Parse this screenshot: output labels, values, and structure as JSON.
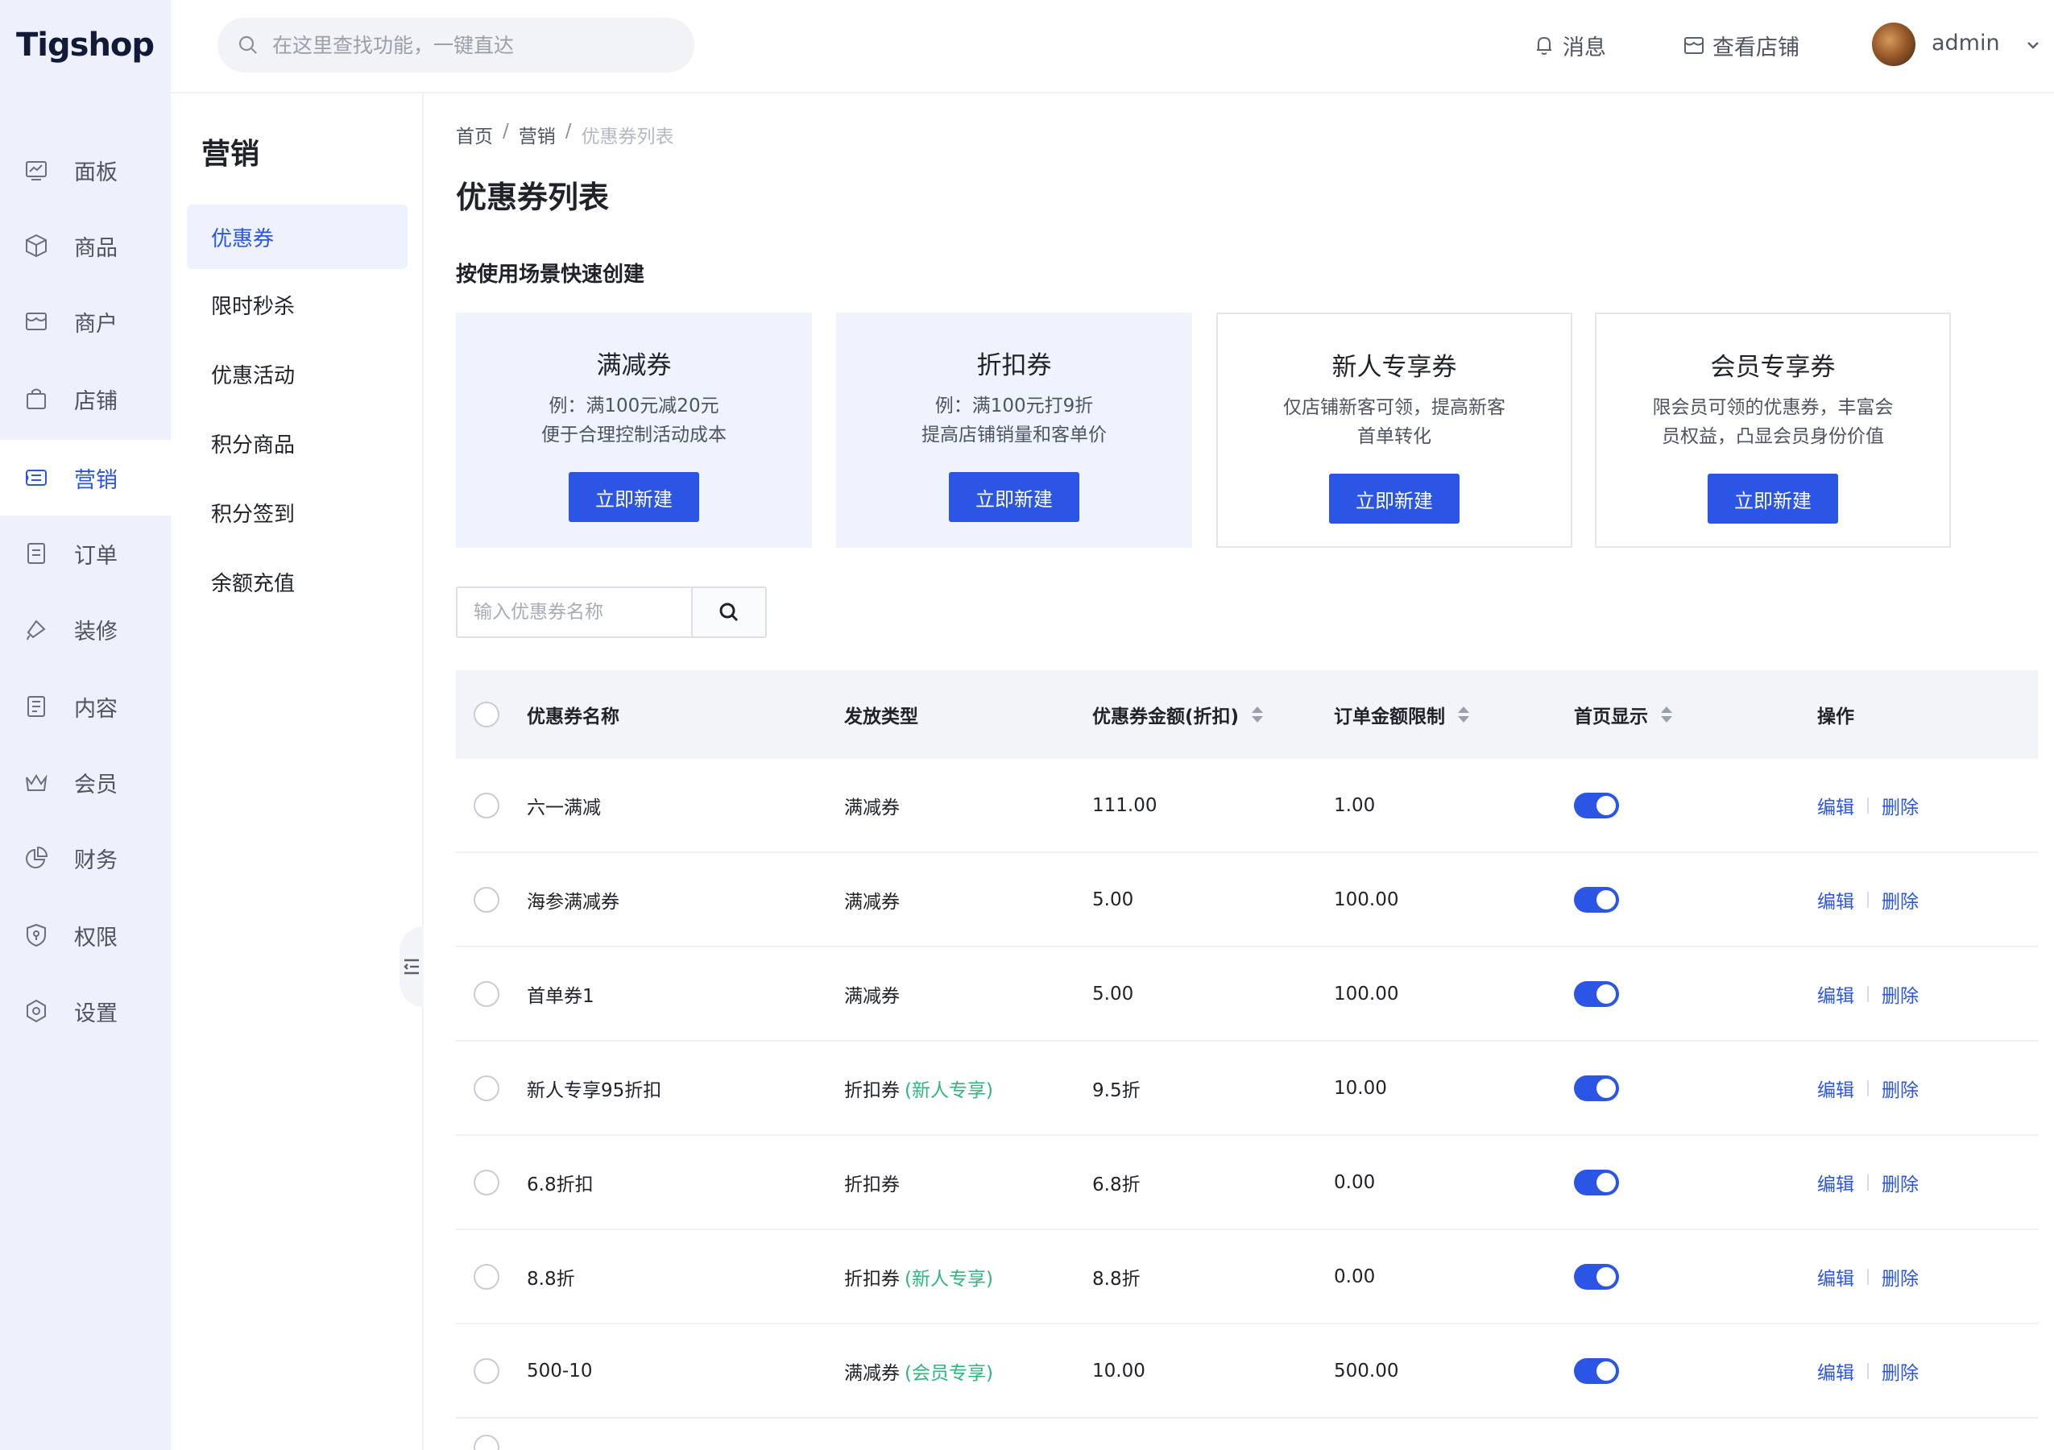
{
  "app": {
    "logo": "Tigshop"
  },
  "rail": [
    {
      "label": "面板",
      "icon": "dashboard-icon"
    },
    {
      "label": "商品",
      "icon": "box-icon"
    },
    {
      "label": "商户",
      "icon": "merchant-icon"
    },
    {
      "label": "店铺",
      "icon": "shop-bag-icon"
    },
    {
      "label": "营销",
      "icon": "marketing-icon",
      "active": true
    },
    {
      "label": "订单",
      "icon": "order-icon"
    },
    {
      "label": "装修",
      "icon": "paint-icon"
    },
    {
      "label": "内容",
      "icon": "content-icon"
    },
    {
      "label": "会员",
      "icon": "crown-icon"
    },
    {
      "label": "财务",
      "icon": "pie-chart-icon"
    },
    {
      "label": "权限",
      "icon": "shield-icon"
    },
    {
      "label": "设置",
      "icon": "settings-icon"
    }
  ],
  "topbar": {
    "search_placeholder": "在这里查找功能，一键直达",
    "messages": "消息",
    "view_shop": "查看店铺",
    "user": "admin"
  },
  "submenu": {
    "title": "营销",
    "items": [
      "优惠券",
      "限时秒杀",
      "优惠活动",
      "积分商品",
      "积分签到",
      "余额充值"
    ]
  },
  "breadcrumb": [
    "首页",
    "营销",
    "优惠券列表"
  ],
  "page_title": "优惠券列表",
  "quick_create": {
    "title": "按使用场景快速创建",
    "cards": [
      {
        "title": "满减券",
        "desc1": "例：满100元减20元",
        "desc2": "便于合理控制活动成本",
        "button": "立即新建"
      },
      {
        "title": "折扣券",
        "desc1": "例：满100元打9折",
        "desc2": "提高店铺销量和客单价",
        "button": "立即新建"
      },
      {
        "title": "新人专享券",
        "desc1": "仅店铺新客可领，提高新客",
        "desc2": "首单转化",
        "button": "立即新建"
      },
      {
        "title": "会员专享券",
        "desc1": "限会员可领的优惠券，丰富会",
        "desc2": "员权益，凸显会员身份价值",
        "button": "立即新建"
      }
    ]
  },
  "coupon_search": {
    "placeholder": "输入优惠券名称"
  },
  "table": {
    "headers": {
      "name": "优惠券名称",
      "type": "发放类型",
      "amount": "优惠券金额(折扣)",
      "limit": "订单金额限制",
      "home": "首页显示",
      "ops": "操作"
    },
    "edit_label": "编辑",
    "delete_label": "删除",
    "rows": [
      {
        "name": "六一满减",
        "type": "满减券",
        "tag": "",
        "amount": "111.00",
        "limit": "1.00",
        "home": true
      },
      {
        "name": "海参满减券",
        "type": "满减券",
        "tag": "",
        "amount": "5.00",
        "limit": "100.00",
        "home": true
      },
      {
        "name": "首单券1",
        "type": "满减券",
        "tag": "",
        "amount": "5.00",
        "limit": "100.00",
        "home": true
      },
      {
        "name": "新人专享95折扣",
        "type": "折扣券",
        "tag": "(新人专享)",
        "amount": "9.5折",
        "limit": "10.00",
        "home": true
      },
      {
        "name": "6.8折扣",
        "type": "折扣券",
        "tag": "",
        "amount": "6.8折",
        "limit": "0.00",
        "home": true
      },
      {
        "name": "8.8折",
        "type": "折扣券",
        "tag": "(新人专享)",
        "amount": "8.8折",
        "limit": "0.00",
        "home": true
      },
      {
        "name": "500-10",
        "type": "满减券",
        "tag": "(会员专享)",
        "amount": "10.00",
        "limit": "500.00",
        "home": true
      }
    ]
  },
  "colors": {
    "accent": "#2a55e5",
    "tag_green": "#2fb67c",
    "rail_bg": "#eef0fb"
  }
}
